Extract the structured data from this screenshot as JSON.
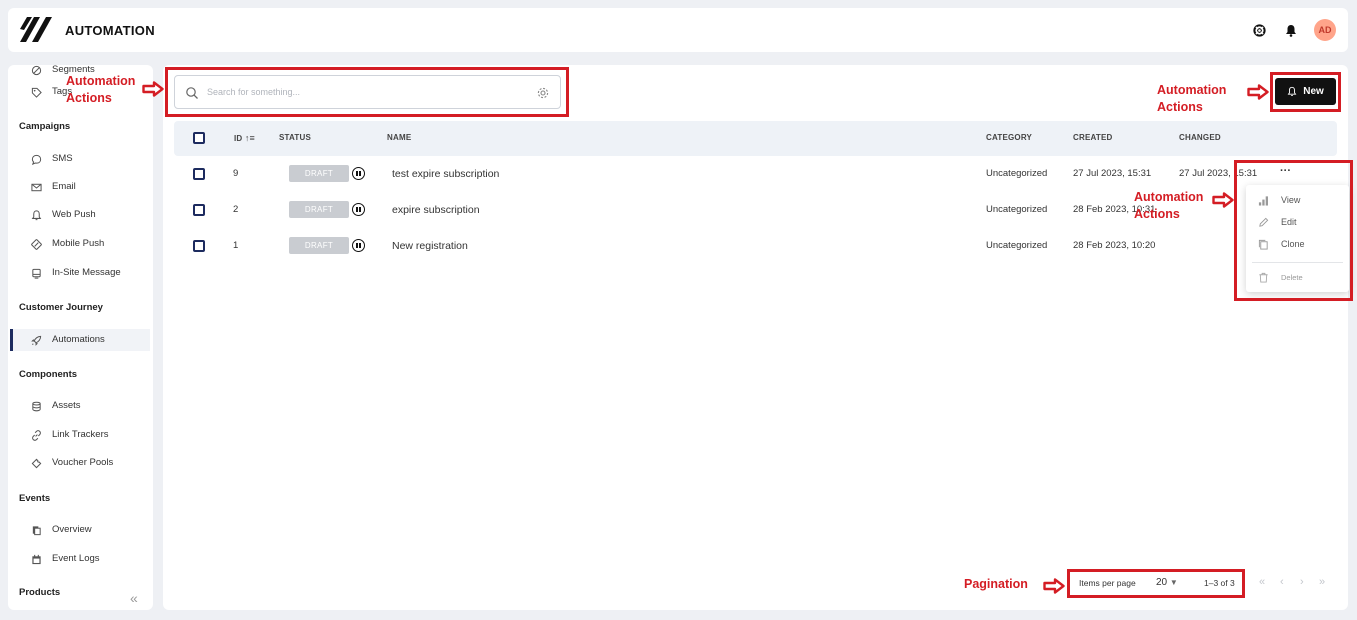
{
  "app": {
    "title": "AUTOMATION",
    "avatar_initials": "AD"
  },
  "sidebar": {
    "items_top": [
      {
        "label": "Segments",
        "icon": "segments-icon"
      },
      {
        "label": "Tags",
        "icon": "tag-icon"
      }
    ],
    "sections": [
      {
        "title": "Campaigns",
        "items": [
          {
            "label": "SMS",
            "icon": "chat-bubble-icon"
          },
          {
            "label": "Email",
            "icon": "envelope-icon"
          },
          {
            "label": "Web Push",
            "icon": "bell-icon"
          },
          {
            "label": "Mobile Push",
            "icon": "mobile-push-icon"
          },
          {
            "label": "In-Site Message",
            "icon": "monitor-icon"
          }
        ]
      },
      {
        "title": "Customer Journey",
        "items": [
          {
            "label": "Automations",
            "icon": "rocket-icon",
            "active": true
          }
        ]
      },
      {
        "title": "Components",
        "items": [
          {
            "label": "Assets",
            "icon": "database-icon"
          },
          {
            "label": "Link Trackers",
            "icon": "link-icon"
          },
          {
            "label": "Voucher Pools",
            "icon": "ticket-icon"
          }
        ]
      },
      {
        "title": "Events",
        "items": [
          {
            "label": "Overview",
            "icon": "overview-icon"
          },
          {
            "label": "Event Logs",
            "icon": "calendar-icon"
          }
        ]
      },
      {
        "title": "Products",
        "items": []
      }
    ],
    "collapse_glyph": "«"
  },
  "search": {
    "placeholder": "Search for something..."
  },
  "toolbar": {
    "new_label": "New"
  },
  "table": {
    "headers": {
      "id": "ID",
      "status": "STATUS",
      "name": "NAME",
      "category": "CATEGORY",
      "created": "CREATED",
      "changed": "CHANGED"
    },
    "rows": [
      {
        "id": "9",
        "status": "DRAFT",
        "name": "test expire subscription",
        "category": "Uncategorized",
        "created": "27 Jul 2023, 15:31",
        "changed": "27 Jul 2023, 15:31"
      },
      {
        "id": "2",
        "status": "DRAFT",
        "name": "expire subscription",
        "category": "Uncategorized",
        "created": "28 Feb 2023, 10:31",
        "changed": ""
      },
      {
        "id": "1",
        "status": "DRAFT",
        "name": "New registration",
        "category": "Uncategorized",
        "created": "28 Feb 2023, 10:20",
        "changed": ""
      }
    ],
    "row_menu_glyph": "···"
  },
  "row_menu": {
    "items": [
      {
        "label": "View",
        "icon": "bar-chart-icon"
      },
      {
        "label": "Edit",
        "icon": "pencil-icon"
      },
      {
        "label": "Clone",
        "icon": "copy-icon"
      },
      {
        "label": "Delete",
        "icon": "trash-icon"
      }
    ]
  },
  "pagination": {
    "items_per_page_label": "Items per page",
    "items_per_page": "20",
    "range": "1–3 of 3"
  },
  "annotations": {
    "search_label": "Automation\nActions",
    "new_label": "Automation\nActions",
    "menu_label": "Automation\nActions",
    "pagination_label": "Pagination",
    "color": "#d41d24"
  },
  "colors": {
    "accent": "#1d2b5f",
    "draft": "#c9ccd1",
    "avatar": "#ffa48a",
    "annotation": "#d41d24"
  }
}
